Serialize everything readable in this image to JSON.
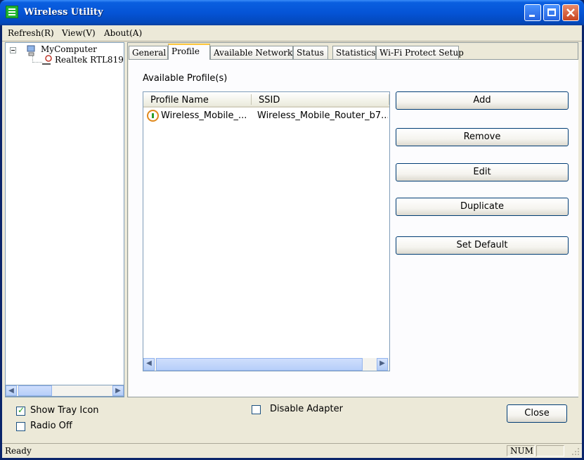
{
  "window": {
    "title": "Wireless Utility"
  },
  "menu": [
    {
      "label": "Refresh(R)"
    },
    {
      "label": "View(V)"
    },
    {
      "label": "About(A)"
    }
  ],
  "tree": {
    "root": "MyComputer",
    "child": "Realtek RTL819"
  },
  "tabs": [
    {
      "label": "General"
    },
    {
      "label": "Profile"
    },
    {
      "label": "Available Network"
    },
    {
      "label": "Status"
    },
    {
      "label": "Statistics"
    },
    {
      "label": "Wi-Fi Protect Setup"
    }
  ],
  "profile": {
    "section_label": "Available Profile(s)",
    "columns": [
      "Profile Name",
      "SSID"
    ],
    "rows": [
      {
        "profile_name": "Wireless_Mobile_...",
        "ssid": "Wireless_Mobile_Router_b7..."
      }
    ],
    "buttons": {
      "add": "Add",
      "remove": "Remove",
      "edit": "Edit",
      "duplicate": "Duplicate",
      "set_default": "Set Default"
    }
  },
  "options": {
    "show_tray_icon": {
      "label": "Show Tray Icon",
      "checked": true
    },
    "radio_off": {
      "label": "Radio Off",
      "checked": false
    },
    "disable_adapter": {
      "label": "Disable Adapter",
      "checked": false
    }
  },
  "close_label": "Close",
  "status": {
    "text": "Ready",
    "num": "NUM"
  }
}
